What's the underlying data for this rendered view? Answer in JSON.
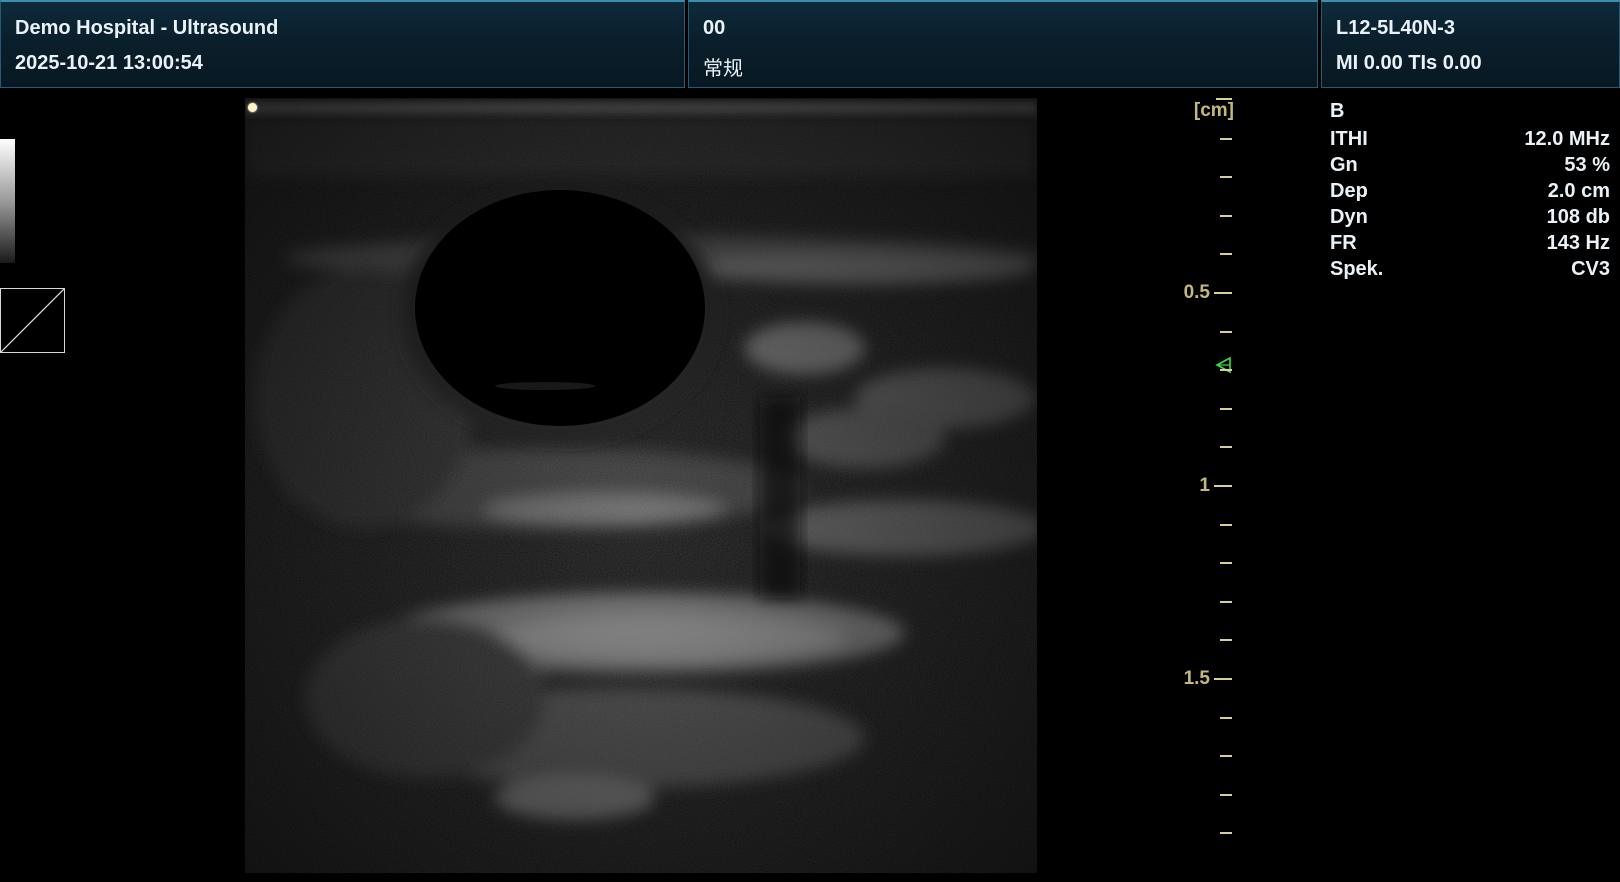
{
  "header": {
    "left": {
      "title": "Demo Hospital - Ultrasound",
      "datetime": "2025-10-21 13:00:54"
    },
    "middle": {
      "patient_id": "00",
      "preset": "常规"
    },
    "right": {
      "probe": "L12-5L40N-3",
      "indices": "MI 0.00  TIs 0.00"
    }
  },
  "scale": {
    "unit": "[cm]",
    "labels": [
      "0.5",
      "1",
      "1.5"
    ],
    "max_depth_cm": 2.0
  },
  "params": {
    "mode": "B",
    "rows": [
      {
        "label": "ITHI",
        "value": "12.0 MHz"
      },
      {
        "label": "Gn",
        "value": "53 %"
      },
      {
        "label": "Dep",
        "value": "2.0 cm"
      },
      {
        "label": "Dyn",
        "value": "108 db"
      },
      {
        "label": "FR",
        "value": "143 Hz"
      },
      {
        "label": "Spek.",
        "value": "CV3"
      }
    ]
  },
  "colors": {
    "scale": "#c4b87a",
    "focus_marker": "#3ddc4a",
    "header_border": "#2a5a72"
  },
  "icons": {
    "focus": "focus-triangle-icon",
    "gray_map": "gray-map-bar",
    "curve": "gamma-curve-icon"
  }
}
